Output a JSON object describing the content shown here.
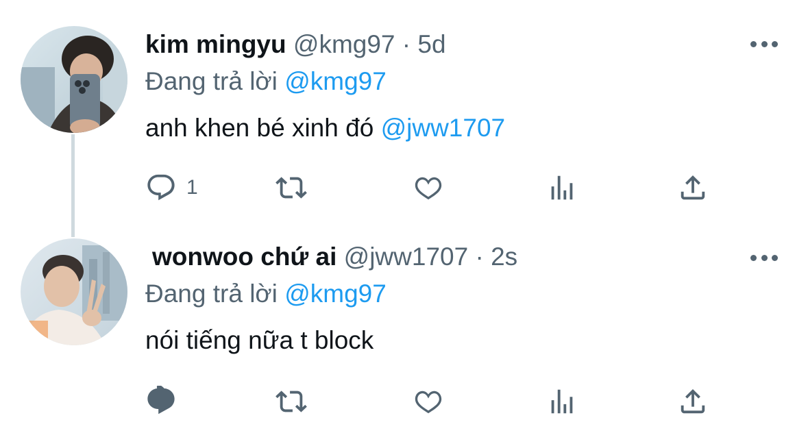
{
  "replying_prefix": "Đang trả lời",
  "colors": {
    "accent": "#1d9bf0",
    "secondary_text": "#536471",
    "primary_text": "#0f1419",
    "thread_line": "#cfd9de"
  },
  "icons": [
    "reply-icon",
    "retweet-icon",
    "like-icon",
    "views-icon",
    "share-icon",
    "more-icon"
  ],
  "tweets": [
    {
      "name": "kim mingyu",
      "handle": "@kmg97",
      "separator": "·",
      "time": "5d",
      "replying_to": "@kmg97",
      "text": "anh khen bé xinh đó ",
      "text_mention": "@jww1707",
      "reply_count": "1"
    },
    {
      "name": "wonwoo chứ ai",
      "handle": "@jww1707",
      "separator": "·",
      "time": "2s",
      "replying_to": "@kmg97",
      "text": "nói tiếng nữa t block",
      "text_mention": "",
      "reply_count": ""
    }
  ]
}
